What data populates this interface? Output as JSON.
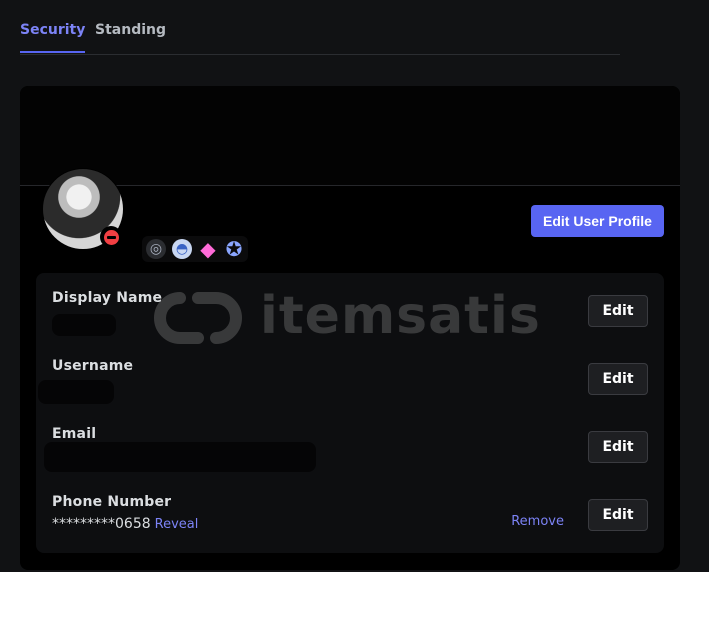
{
  "tabs": [
    {
      "label": "Security",
      "active": true
    },
    {
      "label": "Standing",
      "active": false
    }
  ],
  "profile": {
    "status": "do-not-disturb",
    "edit_button": "Edit User Profile",
    "badges": [
      "boost-badge-icon",
      "helmet-badge-icon",
      "gem-badge-icon",
      "gear-badge-icon"
    ]
  },
  "fields": {
    "display_name": {
      "label": "Display Name",
      "edit": "Edit"
    },
    "username": {
      "label": "Username",
      "edit": "Edit"
    },
    "email": {
      "label": "Email",
      "edit": "Edit"
    },
    "phone": {
      "label": "Phone Number",
      "value": "*********0658",
      "reveal": "Reveal",
      "remove": "Remove",
      "edit": "Edit"
    }
  },
  "watermark": {
    "text": "itemsatis"
  },
  "colors": {
    "accent": "#5865f2",
    "link": "#7c83f6",
    "background": "#111214",
    "dnd": "#f23f43"
  }
}
